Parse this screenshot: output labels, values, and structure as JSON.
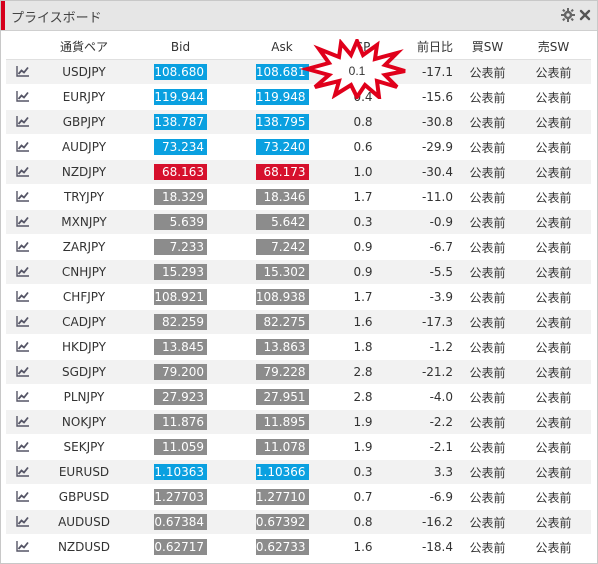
{
  "title": "プライスボード",
  "icons": {
    "settings": "gear-icon",
    "close": "close-icon",
    "row": "chart-line-icon"
  },
  "colors": {
    "blue": "#0aa0e0",
    "red": "#d6102c",
    "grey": "#8c8c8c",
    "accent": "#d6001c"
  },
  "columns": [
    "通貨ペア",
    "Bid",
    "Ask",
    "SP",
    "前日比",
    "買SW",
    "売SW"
  ],
  "rows": [
    {
      "pair": "USDJPY",
      "bid": "108.680",
      "ask": "108.681",
      "sp": "0.1",
      "chg": "-17.1",
      "buy": "公表前",
      "sell": "公表前",
      "color": "blue"
    },
    {
      "pair": "EURJPY",
      "bid": "119.944",
      "ask": "119.948",
      "sp": "0.4",
      "chg": "-15.6",
      "buy": "公表前",
      "sell": "公表前",
      "color": "blue"
    },
    {
      "pair": "GBPJPY",
      "bid": "138.787",
      "ask": "138.795",
      "sp": "0.8",
      "chg": "-30.8",
      "buy": "公表前",
      "sell": "公表前",
      "color": "blue"
    },
    {
      "pair": "AUDJPY",
      "bid": "73.234",
      "ask": "73.240",
      "sp": "0.6",
      "chg": "-29.9",
      "buy": "公表前",
      "sell": "公表前",
      "color": "blue"
    },
    {
      "pair": "NZDJPY",
      "bid": "68.163",
      "ask": "68.173",
      "sp": "1.0",
      "chg": "-30.4",
      "buy": "公表前",
      "sell": "公表前",
      "color": "red"
    },
    {
      "pair": "TRYJPY",
      "bid": "18.329",
      "ask": "18.346",
      "sp": "1.7",
      "chg": "-11.0",
      "buy": "公表前",
      "sell": "公表前",
      "color": "grey"
    },
    {
      "pair": "MXNJPY",
      "bid": "5.639",
      "ask": "5.642",
      "sp": "0.3",
      "chg": "-0.9",
      "buy": "公表前",
      "sell": "公表前",
      "color": "grey"
    },
    {
      "pair": "ZARJPY",
      "bid": "7.233",
      "ask": "7.242",
      "sp": "0.9",
      "chg": "-6.7",
      "buy": "公表前",
      "sell": "公表前",
      "color": "grey"
    },
    {
      "pair": "CNHJPY",
      "bid": "15.293",
      "ask": "15.302",
      "sp": "0.9",
      "chg": "-5.5",
      "buy": "公表前",
      "sell": "公表前",
      "color": "grey"
    },
    {
      "pair": "CHFJPY",
      "bid": "108.921",
      "ask": "108.938",
      "sp": "1.7",
      "chg": "-3.9",
      "buy": "公表前",
      "sell": "公表前",
      "color": "grey"
    },
    {
      "pair": "CADJPY",
      "bid": "82.259",
      "ask": "82.275",
      "sp": "1.6",
      "chg": "-17.3",
      "buy": "公表前",
      "sell": "公表前",
      "color": "grey"
    },
    {
      "pair": "HKDJPY",
      "bid": "13.845",
      "ask": "13.863",
      "sp": "1.8",
      "chg": "-1.2",
      "buy": "公表前",
      "sell": "公表前",
      "color": "grey"
    },
    {
      "pair": "SGDJPY",
      "bid": "79.200",
      "ask": "79.228",
      "sp": "2.8",
      "chg": "-21.2",
      "buy": "公表前",
      "sell": "公表前",
      "color": "grey"
    },
    {
      "pair": "PLNJPY",
      "bid": "27.923",
      "ask": "27.951",
      "sp": "2.8",
      "chg": "-4.0",
      "buy": "公表前",
      "sell": "公表前",
      "color": "grey"
    },
    {
      "pair": "NOKJPY",
      "bid": "11.876",
      "ask": "11.895",
      "sp": "1.9",
      "chg": "-2.2",
      "buy": "公表前",
      "sell": "公表前",
      "color": "grey"
    },
    {
      "pair": "SEKJPY",
      "bid": "11.059",
      "ask": "11.078",
      "sp": "1.9",
      "chg": "-2.1",
      "buy": "公表前",
      "sell": "公表前",
      "color": "grey"
    },
    {
      "pair": "EURUSD",
      "bid": "1.10363",
      "ask": "1.10366",
      "sp": "0.3",
      "chg": "3.3",
      "buy": "公表前",
      "sell": "公表前",
      "color": "blue"
    },
    {
      "pair": "GBPUSD",
      "bid": "1.27703",
      "ask": "1.27710",
      "sp": "0.7",
      "chg": "-6.9",
      "buy": "公表前",
      "sell": "公表前",
      "color": "grey"
    },
    {
      "pair": "AUDUSD",
      "bid": "0.67384",
      "ask": "0.67392",
      "sp": "0.8",
      "chg": "-16.2",
      "buy": "公表前",
      "sell": "公表前",
      "color": "grey"
    },
    {
      "pair": "NZDUSD",
      "bid": "0.62717",
      "ask": "0.62733",
      "sp": "1.6",
      "chg": "-18.4",
      "buy": "公表前",
      "sell": "公表前",
      "color": "grey"
    }
  ]
}
